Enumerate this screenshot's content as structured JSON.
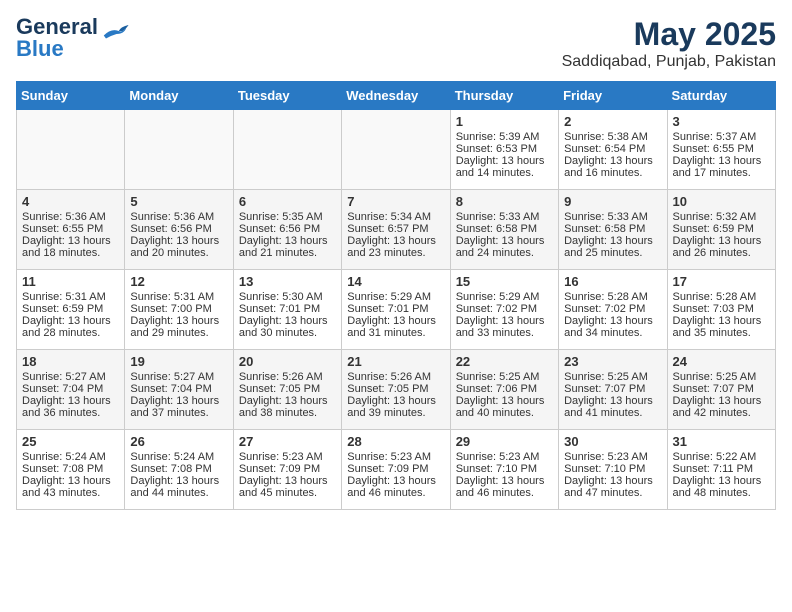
{
  "header": {
    "logo_general": "General",
    "logo_blue": "Blue",
    "month_year": "May 2025",
    "location": "Saddiqabad, Punjab, Pakistan"
  },
  "days_of_week": [
    "Sunday",
    "Monday",
    "Tuesday",
    "Wednesday",
    "Thursday",
    "Friday",
    "Saturday"
  ],
  "weeks": [
    [
      {
        "day": "",
        "content": ""
      },
      {
        "day": "",
        "content": ""
      },
      {
        "day": "",
        "content": ""
      },
      {
        "day": "",
        "content": ""
      },
      {
        "day": "1",
        "content": "Sunrise: 5:39 AM\nSunset: 6:53 PM\nDaylight: 13 hours\nand 14 minutes."
      },
      {
        "day": "2",
        "content": "Sunrise: 5:38 AM\nSunset: 6:54 PM\nDaylight: 13 hours\nand 16 minutes."
      },
      {
        "day": "3",
        "content": "Sunrise: 5:37 AM\nSunset: 6:55 PM\nDaylight: 13 hours\nand 17 minutes."
      }
    ],
    [
      {
        "day": "4",
        "content": "Sunrise: 5:36 AM\nSunset: 6:55 PM\nDaylight: 13 hours\nand 18 minutes."
      },
      {
        "day": "5",
        "content": "Sunrise: 5:36 AM\nSunset: 6:56 PM\nDaylight: 13 hours\nand 20 minutes."
      },
      {
        "day": "6",
        "content": "Sunrise: 5:35 AM\nSunset: 6:56 PM\nDaylight: 13 hours\nand 21 minutes."
      },
      {
        "day": "7",
        "content": "Sunrise: 5:34 AM\nSunset: 6:57 PM\nDaylight: 13 hours\nand 23 minutes."
      },
      {
        "day": "8",
        "content": "Sunrise: 5:33 AM\nSunset: 6:58 PM\nDaylight: 13 hours\nand 24 minutes."
      },
      {
        "day": "9",
        "content": "Sunrise: 5:33 AM\nSunset: 6:58 PM\nDaylight: 13 hours\nand 25 minutes."
      },
      {
        "day": "10",
        "content": "Sunrise: 5:32 AM\nSunset: 6:59 PM\nDaylight: 13 hours\nand 26 minutes."
      }
    ],
    [
      {
        "day": "11",
        "content": "Sunrise: 5:31 AM\nSunset: 6:59 PM\nDaylight: 13 hours\nand 28 minutes."
      },
      {
        "day": "12",
        "content": "Sunrise: 5:31 AM\nSunset: 7:00 PM\nDaylight: 13 hours\nand 29 minutes."
      },
      {
        "day": "13",
        "content": "Sunrise: 5:30 AM\nSunset: 7:01 PM\nDaylight: 13 hours\nand 30 minutes."
      },
      {
        "day": "14",
        "content": "Sunrise: 5:29 AM\nSunset: 7:01 PM\nDaylight: 13 hours\nand 31 minutes."
      },
      {
        "day": "15",
        "content": "Sunrise: 5:29 AM\nSunset: 7:02 PM\nDaylight: 13 hours\nand 33 minutes."
      },
      {
        "day": "16",
        "content": "Sunrise: 5:28 AM\nSunset: 7:02 PM\nDaylight: 13 hours\nand 34 minutes."
      },
      {
        "day": "17",
        "content": "Sunrise: 5:28 AM\nSunset: 7:03 PM\nDaylight: 13 hours\nand 35 minutes."
      }
    ],
    [
      {
        "day": "18",
        "content": "Sunrise: 5:27 AM\nSunset: 7:04 PM\nDaylight: 13 hours\nand 36 minutes."
      },
      {
        "day": "19",
        "content": "Sunrise: 5:27 AM\nSunset: 7:04 PM\nDaylight: 13 hours\nand 37 minutes."
      },
      {
        "day": "20",
        "content": "Sunrise: 5:26 AM\nSunset: 7:05 PM\nDaylight: 13 hours\nand 38 minutes."
      },
      {
        "day": "21",
        "content": "Sunrise: 5:26 AM\nSunset: 7:05 PM\nDaylight: 13 hours\nand 39 minutes."
      },
      {
        "day": "22",
        "content": "Sunrise: 5:25 AM\nSunset: 7:06 PM\nDaylight: 13 hours\nand 40 minutes."
      },
      {
        "day": "23",
        "content": "Sunrise: 5:25 AM\nSunset: 7:07 PM\nDaylight: 13 hours\nand 41 minutes."
      },
      {
        "day": "24",
        "content": "Sunrise: 5:25 AM\nSunset: 7:07 PM\nDaylight: 13 hours\nand 42 minutes."
      }
    ],
    [
      {
        "day": "25",
        "content": "Sunrise: 5:24 AM\nSunset: 7:08 PM\nDaylight: 13 hours\nand 43 minutes."
      },
      {
        "day": "26",
        "content": "Sunrise: 5:24 AM\nSunset: 7:08 PM\nDaylight: 13 hours\nand 44 minutes."
      },
      {
        "day": "27",
        "content": "Sunrise: 5:23 AM\nSunset: 7:09 PM\nDaylight: 13 hours\nand 45 minutes."
      },
      {
        "day": "28",
        "content": "Sunrise: 5:23 AM\nSunset: 7:09 PM\nDaylight: 13 hours\nand 46 minutes."
      },
      {
        "day": "29",
        "content": "Sunrise: 5:23 AM\nSunset: 7:10 PM\nDaylight: 13 hours\nand 46 minutes."
      },
      {
        "day": "30",
        "content": "Sunrise: 5:23 AM\nSunset: 7:10 PM\nDaylight: 13 hours\nand 47 minutes."
      },
      {
        "day": "31",
        "content": "Sunrise: 5:22 AM\nSunset: 7:11 PM\nDaylight: 13 hours\nand 48 minutes."
      }
    ]
  ]
}
